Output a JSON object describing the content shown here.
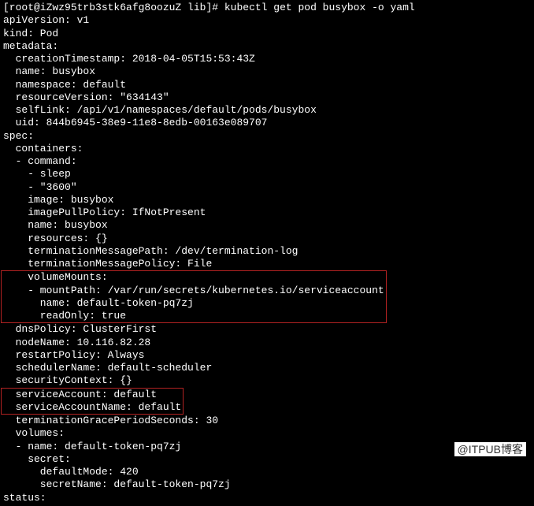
{
  "prompt": "[root@iZwz95trb3stk6afg8oozuZ lib]# ",
  "command": "kubectl get pod busybox -o yaml",
  "out": {
    "l01": "apiVersion: v1",
    "l02": "kind: Pod",
    "l03": "metadata:",
    "l04": "  creationTimestamp: 2018-04-05T15:53:43Z",
    "l05": "  name: busybox",
    "l06": "  namespace: default",
    "l07": "  resourceVersion: \"634143\"",
    "l08": "  selfLink: /api/v1/namespaces/default/pods/busybox",
    "l09": "  uid: 844b6945-38e9-11e8-8edb-00163e089707",
    "l10": "spec:",
    "l11": "  containers:",
    "l12": "  - command:",
    "l13": "    - sleep",
    "l14": "    - \"3600\"",
    "l15": "    image: busybox",
    "l16": "    imagePullPolicy: IfNotPresent",
    "l17": "    name: busybox",
    "l18": "    resources: {}",
    "l19": "    terminationMessagePath: /dev/termination-log",
    "l20": "    terminationMessagePolicy: File",
    "b1_1": "    volumeMounts:",
    "b1_2": "    - mountPath: /var/run/secrets/kubernetes.io/serviceaccount",
    "b1_3": "      name: default-token-pq7zj",
    "b1_4": "      readOnly: true",
    "l21": "  dnsPolicy: ClusterFirst",
    "l22": "  nodeName: 10.116.82.28",
    "l23": "  restartPolicy: Always",
    "l24": "  schedulerName: default-scheduler",
    "l25": "  securityContext: {}",
    "b2_1": "  serviceAccount: default",
    "b2_2": "  serviceAccountName: default",
    "l26": "  terminationGracePeriodSeconds: 30",
    "l27": "  volumes:",
    "l28": "  - name: default-token-pq7zj",
    "l29": "    secret:",
    "l30": "      defaultMode: 420",
    "l31": "      secretName: default-token-pq7zj",
    "l32": "status:"
  },
  "watermark": "@ITPUB博客"
}
